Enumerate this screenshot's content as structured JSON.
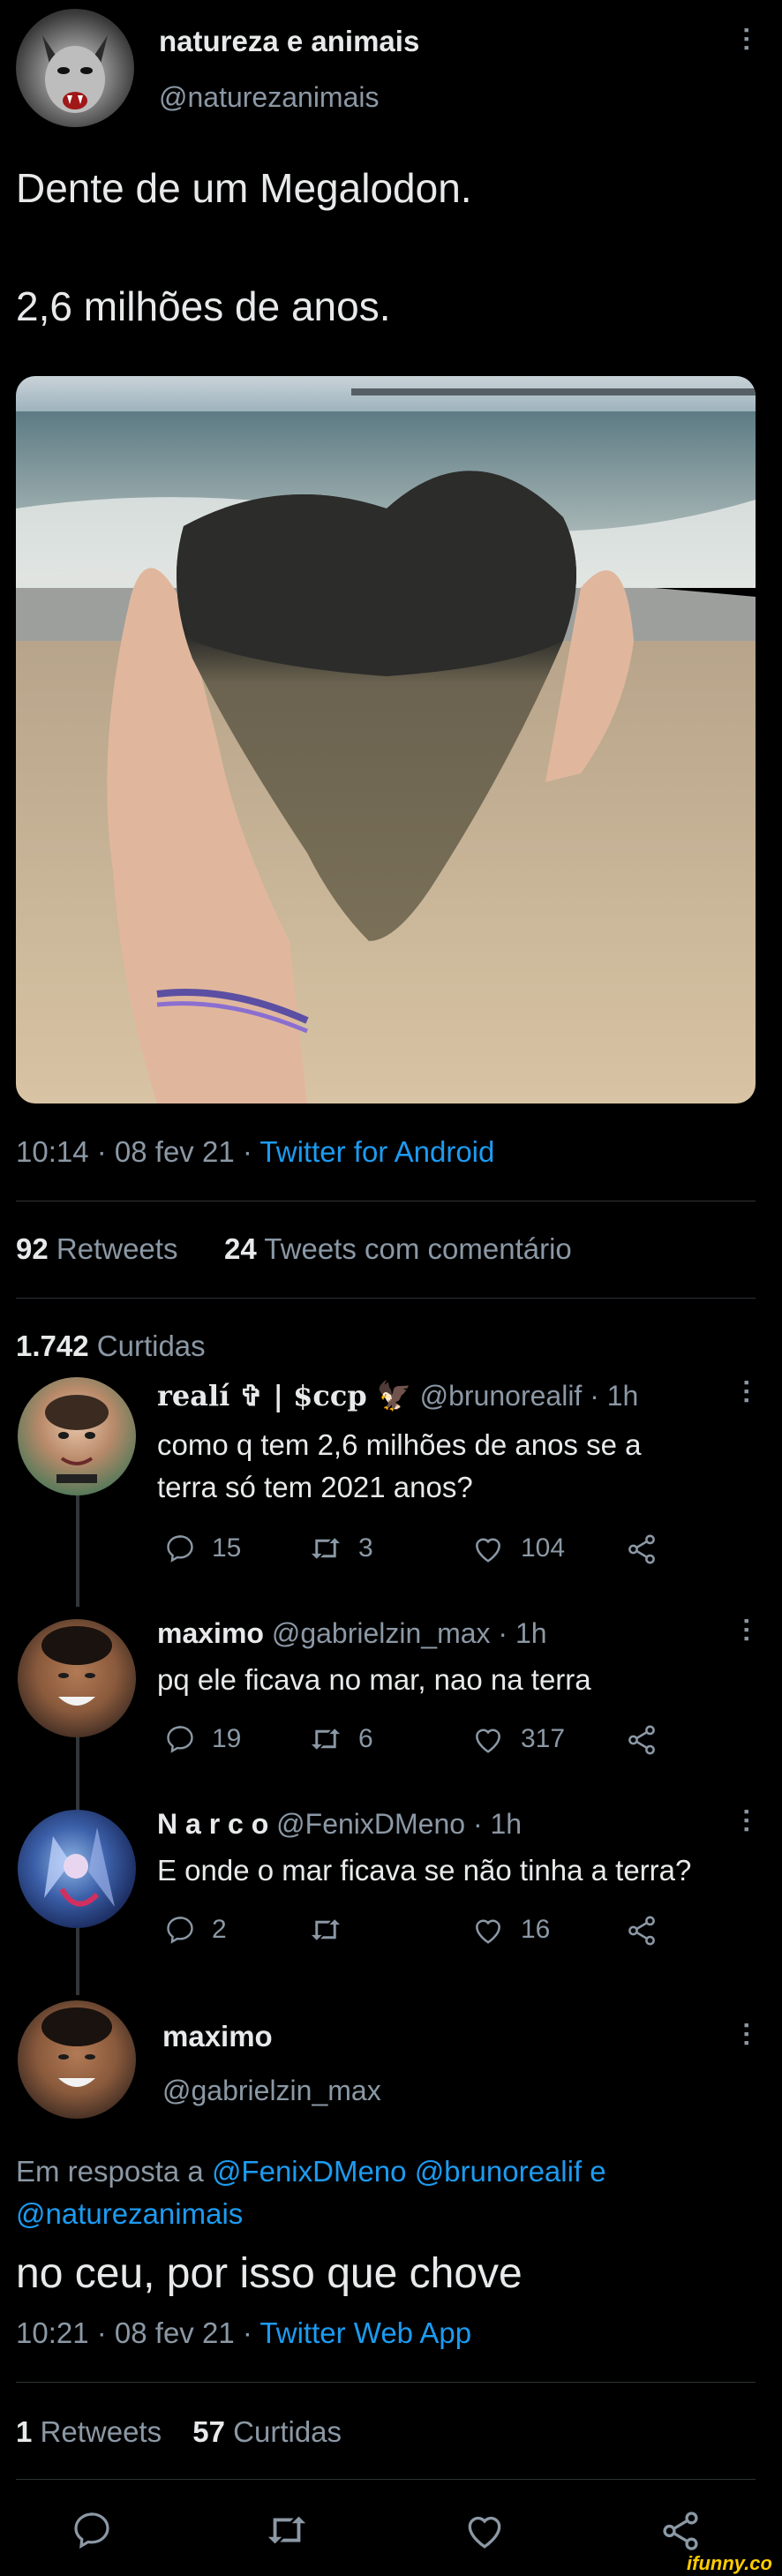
{
  "tweet": {
    "display_name": "natureza e animais",
    "handle": "@naturezanimais",
    "text_line1": "Dente de um Megalodon.",
    "text_line2": "2,6 milhões de anos.",
    "time": "10:14 · 08 fev 21 · ",
    "client": "Twitter for Android",
    "stats": {
      "retweets_count": "92",
      "retweets_label": "Retweets",
      "quotes_count": "24",
      "quotes_label": "Tweets com comentário",
      "likes_count": "1.742",
      "likes_label": "Curtidas"
    }
  },
  "replies": [
    {
      "name": "realí ✞ | $ccp 🦅",
      "handle_time": "@brunorealif · 1h",
      "text_line1": "como q tem 2,6 milhões de anos se a",
      "text_line2": "terra só tem 2021 anos?",
      "replies": "15",
      "retweets": "3",
      "likes": "104"
    },
    {
      "name": "maximo",
      "handle_time": "@gabrielzin_max · 1h",
      "text_line1": "pq ele ficava no mar, nao na terra",
      "replies": "19",
      "retweets": "6",
      "likes": "317"
    },
    {
      "name": "N a r c o",
      "handle_time": "@FenixDMeno · 1h",
      "text_line1": "E onde o mar ficava se não tinha a terra?",
      "replies": "2",
      "retweets": "",
      "likes": "16"
    }
  ],
  "focused_reply": {
    "name": "maximo",
    "handle": "@gabrielzin_max",
    "reply_prefix": "Em resposta a ",
    "mention1": "@FenixDMeno",
    "mention2": "@brunorealif",
    "and_word": " e",
    "mention3": "@naturezanimais",
    "text": "no ceu, por isso que chove",
    "time": "10:21 · 08 fev 21 · ",
    "client": "Twitter Web App",
    "retweets_count": "1",
    "retweets_label": "Retweets",
    "likes_count": "57",
    "likes_label": "Curtidas"
  },
  "watermark": "ifunny.co",
  "colors": {
    "link": "#1d9bf0",
    "muted": "#8b98a5",
    "text": "#e7e9ea",
    "watermark": "#ffcc00"
  }
}
